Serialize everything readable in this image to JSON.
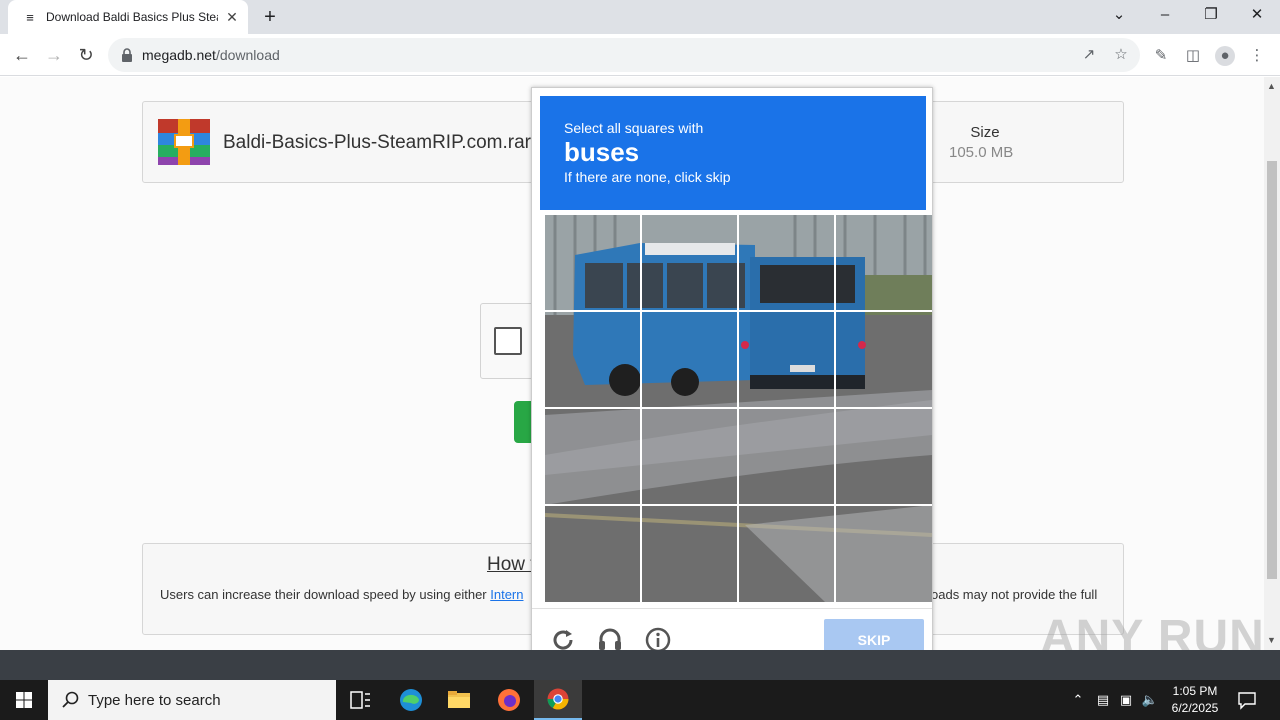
{
  "browser": {
    "tab_title": "Download Baldi Basics Plus Steam",
    "url_domain": "megadb.net",
    "url_path": "/download"
  },
  "page": {
    "filename": "Baldi-Basics-Plus-SteamRIP.com.rar",
    "size_label": "Size",
    "size_value": "105.0 MB",
    "info_heading": "How t",
    "info_text_left": "Users can increase their download speed by using either ",
    "info_link": "Intern",
    "info_text_right": "oads may not provide the full"
  },
  "captcha": {
    "prompt_line1": "Select all squares with",
    "keyword": "buses",
    "prompt_line3": "If there are none, click skip",
    "skip_label": "SKIP"
  },
  "watermark": "ANY RUN",
  "taskbar": {
    "search_placeholder": "Type here to search",
    "time": "1:05 PM",
    "date": "6/2/2025"
  },
  "colors": {
    "captcha_header": "#1a73e8",
    "skip_button": "#a9c8f2",
    "download_button": "#28a745"
  }
}
